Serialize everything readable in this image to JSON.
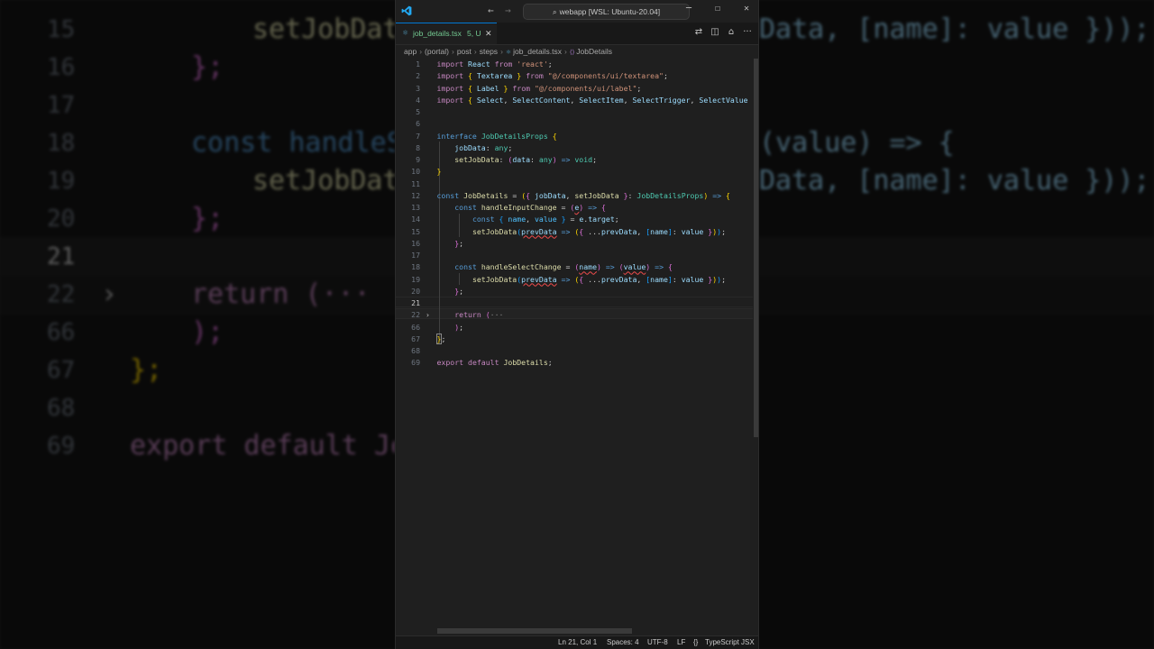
{
  "titlebar": {
    "search_text": "webapp [WSL: Ubuntu-20.04]",
    "back_icon": "arrow-left-icon",
    "forward_icon": "arrow-right-icon",
    "minimize_icon": "minimize-icon",
    "maximize_icon": "maximize-icon",
    "close_icon": "close-icon"
  },
  "tab": {
    "filename": "job_details.tsx",
    "status": "5, U",
    "close": "✕"
  },
  "breadcrumb": {
    "items": [
      "app",
      "(portal)",
      "post",
      "steps",
      "job_details.tsx",
      "JobDetails"
    ]
  },
  "editor": {
    "line_numbers": [
      "1",
      "2",
      "3",
      "4",
      "5",
      "6",
      "7",
      "8",
      "9",
      "10",
      "11",
      "12",
      "13",
      "14",
      "15",
      "16",
      "17",
      "18",
      "19",
      "20",
      "21",
      "22",
      "66",
      "67",
      "68",
      "69"
    ],
    "current_line": "21"
  },
  "background": {
    "line_numbers": [
      "15",
      "16",
      "17",
      "18",
      "19",
      "20",
      "21",
      "22",
      "66",
      "67",
      "68",
      "69"
    ],
    "texts": {
      "l15": "setJobData",
      "l16": "};",
      "l18": "const handleSe",
      "l19": "setJobData",
      "l20": "};",
      "l22": "return (···",
      "l66": ");",
      "l67": "};",
      "l69": "export default Job",
      "r15": "Data, [name]: value }));",
      "r18": "(value) => {",
      "r19": "Data, [name]: value }));"
    }
  },
  "statusbar": {
    "position": "Ln 21, Col 1",
    "spaces": "Spaces: 4",
    "encoding": "UTF-8",
    "eol": "LF",
    "braces": "{}",
    "language": "TypeScript JSX"
  },
  "colors": {
    "accent": "#0078d4",
    "untracked": "#73c991",
    "keyword": "#569cd6",
    "string": "#ce9178",
    "type": "#4ec9b0",
    "function": "#dcdcaa",
    "variable": "#9cdcfe"
  }
}
